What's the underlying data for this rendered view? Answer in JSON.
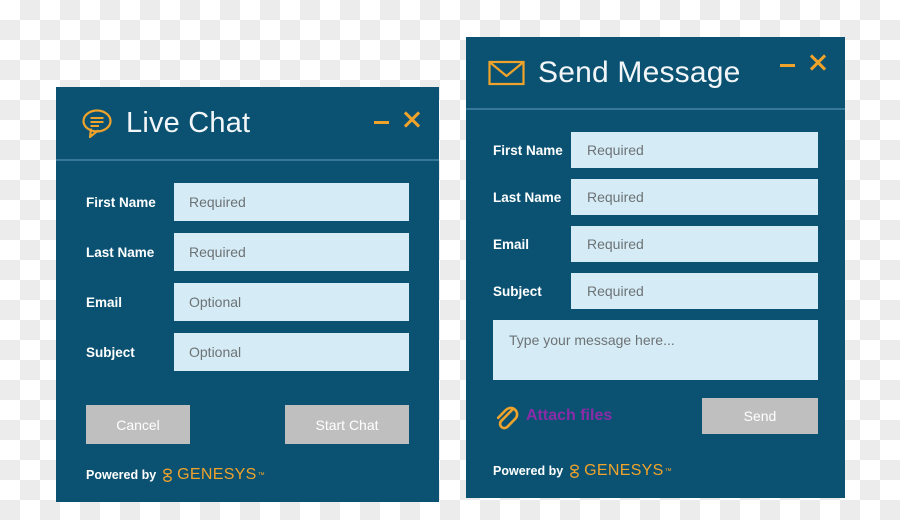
{
  "background": {
    "type": "transparency-checkerboard",
    "light": "#ffffff",
    "dark": "#ececec"
  },
  "theme": {
    "panel_bg": "#0b5272",
    "accent_orange": "#f0a32a",
    "input_bg": "#d5ecf6",
    "placeholder_color": "#6d7275",
    "button_bg": "#bfbfbf",
    "button_text": "#ffffff",
    "attach_link_color": "#8b2ba8",
    "divider": "#3f7f9e"
  },
  "chat_panel": {
    "title": "Live Chat",
    "title_icon": "speech-bubble-icon",
    "minimize_label": "Minimize",
    "close_label": "Close",
    "fields": [
      {
        "label": "First Name",
        "placeholder": "Required",
        "value": ""
      },
      {
        "label": "Last Name",
        "placeholder": "Required",
        "value": ""
      },
      {
        "label": "Email",
        "placeholder": "Optional",
        "value": ""
      },
      {
        "label": "Subject",
        "placeholder": "Optional",
        "value": ""
      }
    ],
    "cancel_label": "Cancel",
    "start_label": "Start Chat",
    "footer": {
      "powered_by": "Powered by",
      "brand": "GENESYS",
      "trademark": "™"
    }
  },
  "message_panel": {
    "title": "Send Message",
    "title_icon": "envelope-icon",
    "minimize_label": "Minimize",
    "close_label": "Close",
    "fields": [
      {
        "label": "First Name",
        "placeholder": "Required",
        "value": ""
      },
      {
        "label": "Last Name",
        "placeholder": "Required",
        "value": ""
      },
      {
        "label": "Email",
        "placeholder": "Required",
        "value": ""
      },
      {
        "label": "Subject",
        "placeholder": "Required",
        "value": ""
      }
    ],
    "message_placeholder": "Type your message here...",
    "message_value": "",
    "attach_label": "Attach files",
    "attach_icon": "paperclip-icon",
    "send_label": "Send",
    "footer": {
      "powered_by": "Powered by",
      "brand": "GENESYS",
      "trademark": "™"
    }
  }
}
